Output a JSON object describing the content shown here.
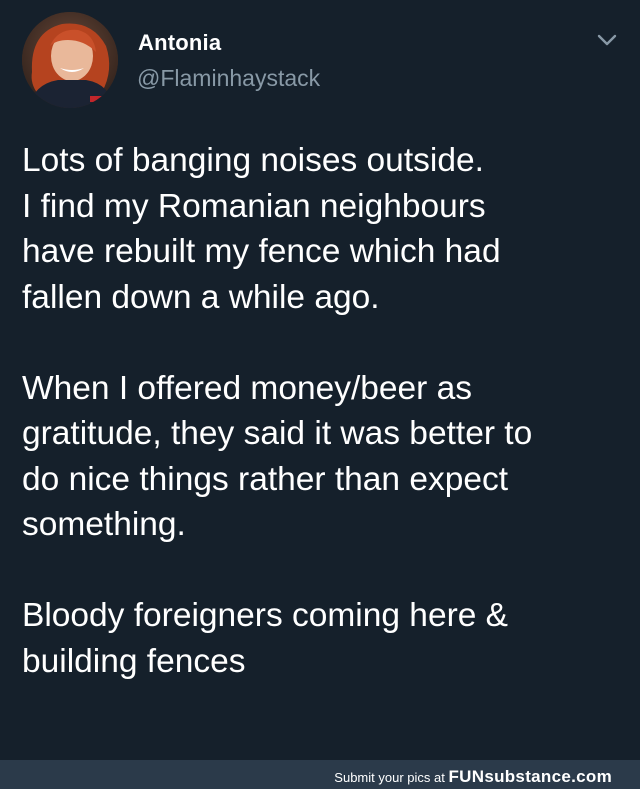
{
  "tweet": {
    "author": {
      "display_name": "Antonia",
      "handle": "@Flaminhaystack",
      "avatar_icon": "profile-photo"
    },
    "menu_icon": "chevron-down-icon",
    "paragraphs": [
      "Lots of banging noises outside.\nI find my Romanian neighbours\nhave rebuilt my fence which had\nfallen down a while ago.",
      "When I offered money/beer as\ngratitude, they said it was better to\ndo nice things rather than expect\nsomething.",
      "Bloody foreigners coming here &\nbuilding fences"
    ]
  },
  "footer": {
    "submit_text": "Submit your pics at",
    "brand_fun": "FUN",
    "brand_substance": "substance",
    "brand_suffix": ".com"
  },
  "colors": {
    "background": "#15202b",
    "handle": "#8899a6",
    "footer_bar": "#2b3a4a",
    "text": "#ffffff"
  }
}
